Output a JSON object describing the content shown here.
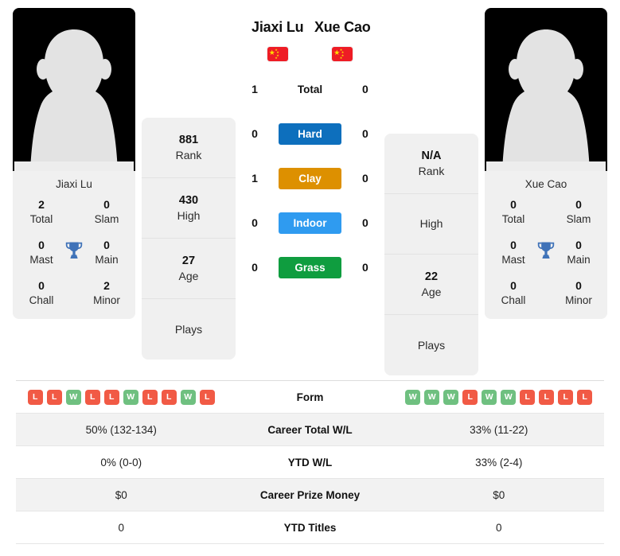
{
  "players": {
    "left": {
      "name": "Jiaxi Lu",
      "country_flag": "cn-flag-icon",
      "avatar_name": "Jiaxi Lu",
      "trophies": [
        {
          "num": "2",
          "label": "Total"
        },
        {
          "num": "0",
          "label": "Slam"
        },
        {
          "num": "0",
          "label": "Mast"
        },
        {
          "num": "0",
          "label": "Main"
        },
        {
          "num": "0",
          "label": "Chall"
        },
        {
          "num": "2",
          "label": "Minor"
        }
      ],
      "mid_stats": [
        {
          "num": "881",
          "label": "Rank"
        },
        {
          "num": "430",
          "label": "High"
        },
        {
          "num": "27",
          "label": "Age"
        },
        {
          "num": "",
          "label": "Plays"
        }
      ],
      "form": [
        "L",
        "L",
        "W",
        "L",
        "L",
        "W",
        "L",
        "L",
        "W",
        "L"
      ],
      "career_total_wl": "50% (132-134)",
      "ytd_wl": "0% (0-0)",
      "career_prize_money": "$0",
      "ytd_titles": "0"
    },
    "right": {
      "name": "Xue Cao",
      "country_flag": "cn-flag-icon",
      "avatar_name": "Xue Cao",
      "trophies": [
        {
          "num": "0",
          "label": "Total"
        },
        {
          "num": "0",
          "label": "Slam"
        },
        {
          "num": "0",
          "label": "Mast"
        },
        {
          "num": "0",
          "label": "Main"
        },
        {
          "num": "0",
          "label": "Chall"
        },
        {
          "num": "0",
          "label": "Minor"
        }
      ],
      "mid_stats": [
        {
          "num": "N/A",
          "label": "Rank"
        },
        {
          "num": "",
          "label": "High"
        },
        {
          "num": "22",
          "label": "Age"
        },
        {
          "num": "",
          "label": "Plays"
        }
      ],
      "form": [
        "W",
        "W",
        "W",
        "L",
        "W",
        "W",
        "L",
        "L",
        "L",
        "L"
      ],
      "career_total_wl": "33% (11-22)",
      "ytd_wl": "33% (2-4)",
      "career_prize_money": "$0",
      "ytd_titles": "0"
    }
  },
  "head_to_head": [
    {
      "label": "Total",
      "left": "1",
      "right": "0",
      "color": ""
    },
    {
      "label": "Hard",
      "left": "0",
      "right": "0",
      "color": "#0d6fbd"
    },
    {
      "label": "Clay",
      "left": "1",
      "right": "0",
      "color": "#dd9000"
    },
    {
      "label": "Indoor",
      "left": "0",
      "right": "0",
      "color": "#2f9bf0"
    },
    {
      "label": "Grass",
      "left": "0",
      "right": "0",
      "color": "#0f9d3f"
    }
  ],
  "table_rows": [
    {
      "label": "Form"
    },
    {
      "label": "Career Total W/L"
    },
    {
      "label": "YTD W/L"
    },
    {
      "label": "Career Prize Money"
    },
    {
      "label": "YTD Titles"
    }
  ],
  "colors": {
    "win": "#6fc080",
    "loss": "#f15a45",
    "card_bg": "#f0f0f0",
    "row_alt_bg": "#f2f2f2",
    "flag_red": "#ee1c25",
    "flag_yellow": "#ffde00",
    "trophy": "#3f72b8"
  }
}
